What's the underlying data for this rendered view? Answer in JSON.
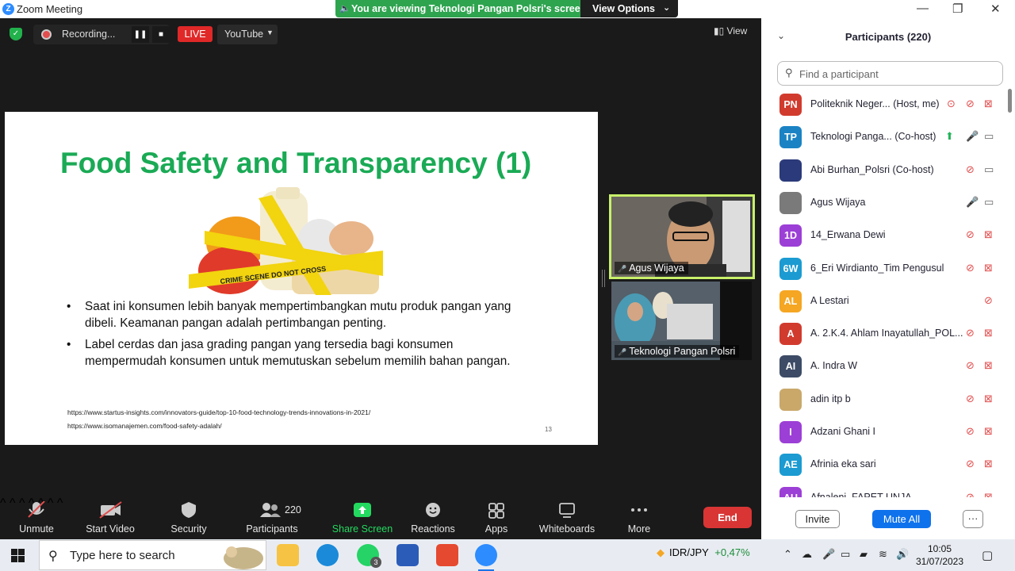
{
  "window": {
    "title": "Zoom Meeting",
    "controls": [
      "—",
      "❐",
      "✕"
    ]
  },
  "banner": {
    "message": "You are viewing Teknologi Pangan Polsri's screen",
    "view_options": "View Options"
  },
  "topbar": {
    "recording_label": "Recording...",
    "live_label": "LIVE",
    "stream_target": "YouTube",
    "view_label": "View"
  },
  "slide": {
    "title": "Food Safety and Transparency (1)",
    "bullets": [
      "Saat ini konsumen lebih banyak mempertimbangkan mutu produk pangan yang dibeli.  Keamanan pangan adalah pertimbangan penting.",
      "Label cerdas dan jasa grading pangan yang tersedia bagi konsumen mempermudah konsumen untuk memutuskan sebelum memilih bahan pangan."
    ],
    "references": [
      "https://www.startus-insights.com/innovators-guide/top-10-food-technology-trends-innovations-in-2021/",
      "https://www.isomanajemen.com/food-safety-adalah/"
    ],
    "page_number": "13",
    "tape_text": "CRIME SCENE DO NOT CROSS"
  },
  "videos": [
    {
      "name": "Agus Wijaya"
    },
    {
      "name": "Teknologi Pangan Polsri"
    }
  ],
  "toolbar": {
    "unmute": "Unmute",
    "start_video": "Start Video",
    "security": "Security",
    "participants": "Participants",
    "participants_count": "220",
    "share_screen": "Share Screen",
    "reactions": "Reactions",
    "apps": "Apps",
    "whiteboards": "Whiteboards",
    "more": "More",
    "end": "End"
  },
  "panel": {
    "title": "Participants (220)",
    "search_placeholder": "Find a participant",
    "invite": "Invite",
    "mute_all": "Mute All",
    "more": "···",
    "participants": [
      {
        "initials": "PN",
        "color": "#d13b2e",
        "name": "Politeknik Neger... (Host, me)",
        "mic": "muted",
        "video": "off",
        "rec": true
      },
      {
        "initials": "TP",
        "color": "#1b83c4",
        "name": "Teknologi Panga...  (Co-host)",
        "mic": "on",
        "video": "on",
        "share": true
      },
      {
        "initials": "",
        "color": "#2b3a7a",
        "name": "Abi Burhan_Polsri (Co-host)",
        "mic": "muted",
        "video": "on",
        "photo": true
      },
      {
        "initials": "",
        "color": "#7a7a7a",
        "name": "Agus Wijaya",
        "mic": "on",
        "video": "on",
        "photo": true
      },
      {
        "initials": "1D",
        "color": "#9c3fd6",
        "name": "14_Erwana Dewi",
        "mic": "muted",
        "video": "off"
      },
      {
        "initials": "6W",
        "color": "#1b9bd1",
        "name": "6_Eri Wirdianto_Tim Pengusul",
        "mic": "muted",
        "video": "off"
      },
      {
        "initials": "AL",
        "color": "#f5a623",
        "name": "A Lestari",
        "mic": "muted",
        "video": "none"
      },
      {
        "initials": "A",
        "color": "#d13b2e",
        "name": "A. 2.K.4. Ahlam Inayatullah_POL...",
        "mic": "muted",
        "video": "off"
      },
      {
        "initials": "AI",
        "color": "#3d4b66",
        "name": "A. Indra W",
        "mic": "muted",
        "video": "off"
      },
      {
        "initials": "",
        "color": "#c9a86a",
        "name": "adin itp b",
        "mic": "muted",
        "video": "off",
        "photo": true
      },
      {
        "initials": "I",
        "color": "#9c3fd6",
        "name": "Adzani Ghani I",
        "mic": "muted",
        "video": "off"
      },
      {
        "initials": "AE",
        "color": "#1b9bd1",
        "name": "Afrinia eka sari",
        "mic": "muted",
        "video": "off"
      },
      {
        "initials": "AU",
        "color": "#9c3fd6",
        "name": "Afnaleni_FAPET UNJA",
        "mic": "muted",
        "video": "off"
      }
    ]
  },
  "taskbar": {
    "search_placeholder": "Type here to search",
    "whatsapp_badge": "3",
    "fx_pair": "IDR/JPY",
    "fx_change": "+0,47%",
    "time": "10:05",
    "date": "31/07/2023",
    "colors": {
      "fx_up": "#1e8c3a"
    }
  }
}
